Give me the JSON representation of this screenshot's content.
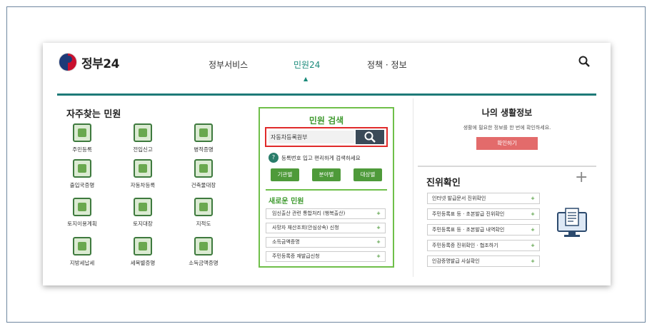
{
  "header": {
    "logo_text": "정부24",
    "nav": [
      "정부서비스",
      "민원24",
      "정책 · 정보"
    ],
    "active_nav": "민원24"
  },
  "left": {
    "title": "자주찾는 민원",
    "tiles": [
      "주민등록",
      "전입신고",
      "병적증명",
      "출입국증명",
      "자동차등록",
      "건축물대장",
      "토지이용계획",
      "토지대장",
      "지적도",
      "지방세납세",
      "세목별증명",
      "소득금액증명"
    ]
  },
  "middle": {
    "title": "민원 검색",
    "search_value": "자동차등록원부",
    "hint": "등록번호 입고 편리하게 검색하세요",
    "filter_buttons": [
      "기관별",
      "분야별",
      "대상별"
    ],
    "new_title": "새로운 민원",
    "new_items": [
      "임신출산 관련 통합처리 (행복출산)",
      "사망자 재산조회(안심상속) 신청",
      "소득금액증명",
      "주민등록증 재발급신청"
    ]
  },
  "right": {
    "life_title": "나의 생활정보",
    "life_desc": "생활에 필요한 정보를 한 번에 확인하세요.",
    "life_button": "확인하기",
    "verify_title": "진위확인",
    "verify_items": [
      "인터넷 발급문서 진위확인",
      "주민등록표 등 · 초본발급 진위확인",
      "주민등록표 등 · 초본발급 내역확인",
      "주민등록증 진위확인 · 협조하기",
      "인감증명발급 사실확인"
    ]
  },
  "colors": {
    "accent_green": "#4e9a3a",
    "teal": "#1e7a78",
    "highlight_red": "#e02a2a",
    "button_pink": "#e36b6b"
  }
}
